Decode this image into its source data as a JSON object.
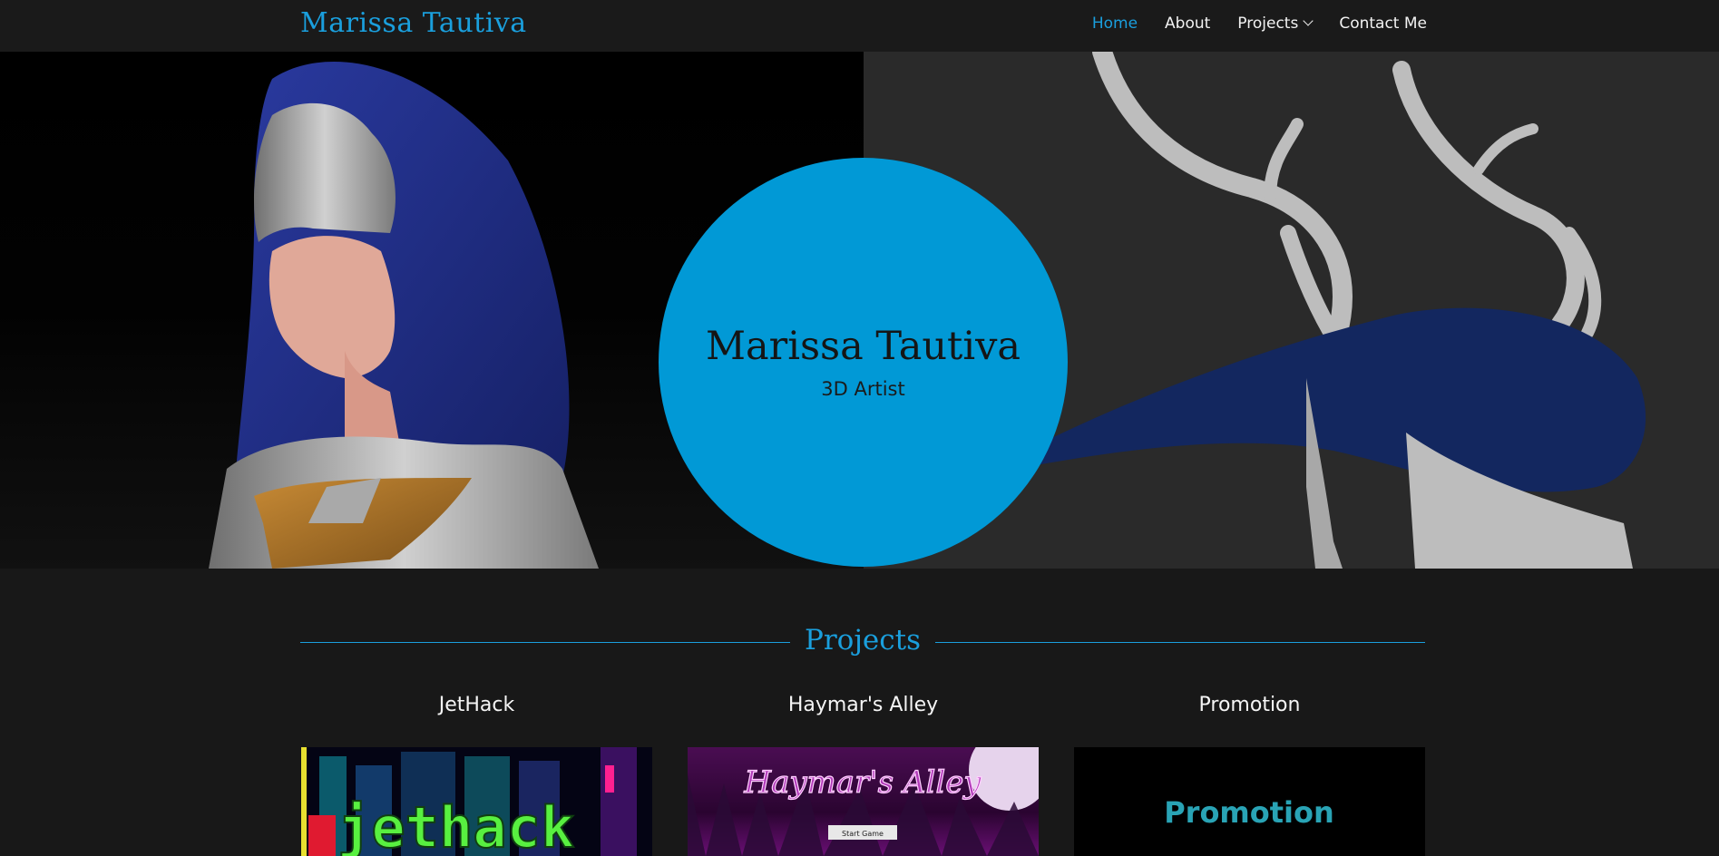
{
  "nav": {
    "brand": "Marissa Tautiva",
    "links": {
      "home": "Home",
      "about": "About",
      "projects": "Projects",
      "contact": "Contact Me"
    }
  },
  "hero": {
    "name": "Marissa Tautiva",
    "role": "3D Artist"
  },
  "projects": {
    "heading": "Projects",
    "items": [
      {
        "title": "JetHack",
        "image_text": "jethack"
      },
      {
        "title": "Haymar's Alley",
        "image_text": "Haymar's Alley",
        "button": "Start Game"
      },
      {
        "title": "Promotion",
        "image_text": "Promotion"
      }
    ]
  },
  "colors": {
    "accent": "#1a9fdd",
    "circle": "#0199d6",
    "nav_bg": "#1a1a1a",
    "page_bg": "#181818"
  }
}
